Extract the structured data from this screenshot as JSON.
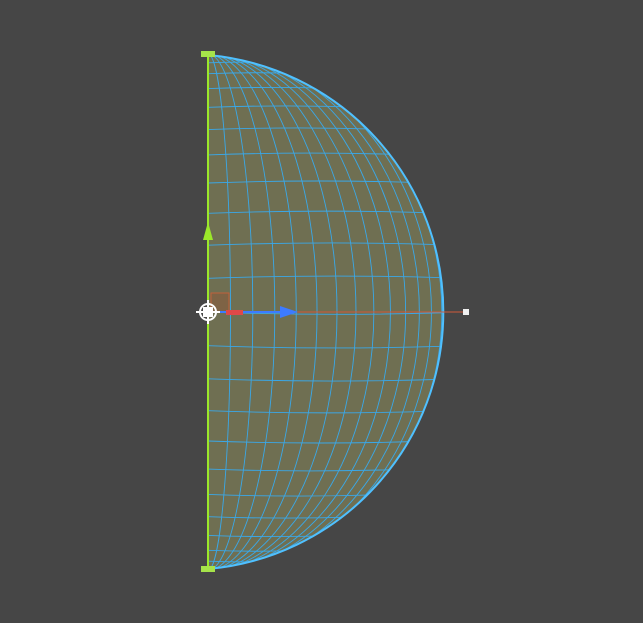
{
  "viewport": {
    "background_color": "#464646"
  },
  "mesh": {
    "shape": "hemisphere",
    "fill_color": "#6f6f52",
    "wire_color": "#3aa8e8",
    "outline_color": "#4fc0ff",
    "meridians": 18,
    "parallels": 24
  },
  "gizmo": {
    "pivot_icon": "pivot-crosshair-icon",
    "y_axis_color": "#9be82a",
    "x_axis_color": "#e04848",
    "z_axis_color": "#3d7bff",
    "ray_color": "#d05a3a",
    "edge_handle_color": "#a6e34a",
    "plane_handle_color": "#c0603a"
  }
}
